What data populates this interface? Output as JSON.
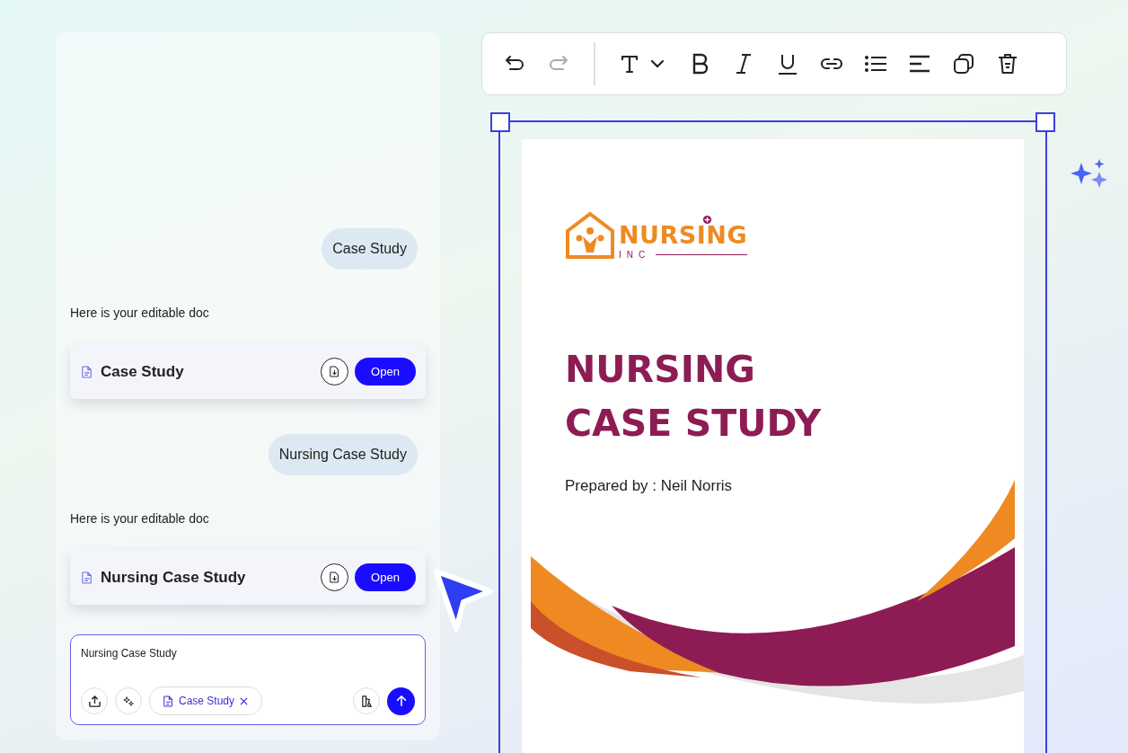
{
  "chat": {
    "messages": [
      {
        "kind": "user",
        "text": "Case Study"
      },
      {
        "kind": "bot",
        "text": "Here is your editable doc"
      },
      {
        "kind": "doc",
        "title": "Case Study",
        "button": "Open"
      },
      {
        "kind": "user",
        "text": "Nursing Case Study"
      },
      {
        "kind": "bot",
        "text": "Here is your editable doc"
      },
      {
        "kind": "doc",
        "title": "Nursing Case Study",
        "button": "Open"
      }
    ],
    "composer": {
      "value": "Nursing Case Study",
      "attachment": "Case Study"
    }
  },
  "toolbar": {
    "undo": {
      "disabled": false
    },
    "redo": {
      "disabled": true
    }
  },
  "document": {
    "logo_name": "NURSING",
    "logo_sub": "INC",
    "title_lines": [
      "NURSING",
      "CASE STUDY"
    ],
    "prepared_by": "Prepared by : Neil Norris"
  }
}
